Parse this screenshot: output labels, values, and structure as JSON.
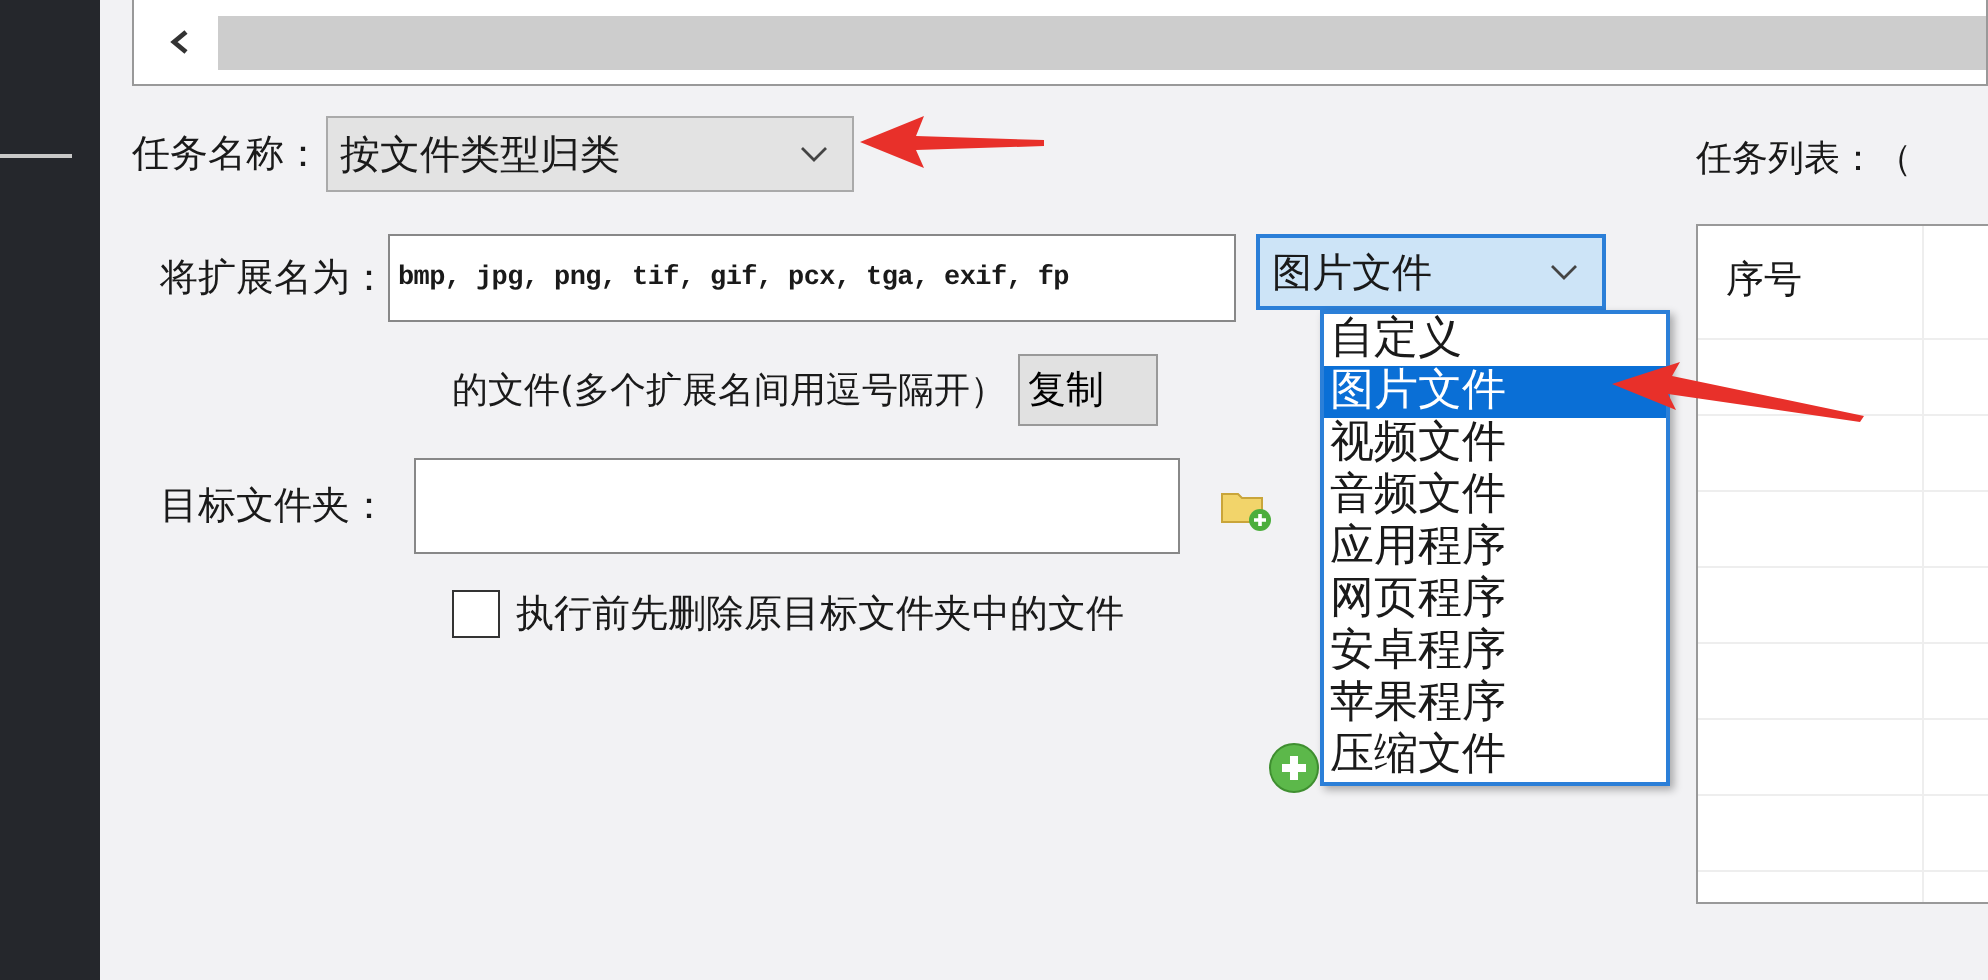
{
  "task_name": {
    "label": "任务名称：",
    "value": "按文件类型归类"
  },
  "extension": {
    "label": "将扩展名为：",
    "value": "bmp, jpg, png, tif, gif, pcx, tga, exif, fp",
    "category": "图片文件",
    "hint": "的文件(多个扩展名间用逗号隔开）",
    "copy_button": "复制"
  },
  "category_options": [
    {
      "label": "自定义",
      "selected": false
    },
    {
      "label": "图片文件",
      "selected": true
    },
    {
      "label": "视频文件",
      "selected": false
    },
    {
      "label": "音频文件",
      "selected": false
    },
    {
      "label": "应用程序",
      "selected": false
    },
    {
      "label": "网页程序",
      "selected": false
    },
    {
      "label": "安卓程序",
      "selected": false
    },
    {
      "label": "苹果程序",
      "selected": false
    },
    {
      "label": "压缩文件",
      "selected": false
    }
  ],
  "target_folder": {
    "label": "目标文件夹："
  },
  "delete_first": {
    "label": "执行前先删除原目标文件夹中的文件",
    "checked": false
  },
  "task_list": {
    "label": "任务列表：（",
    "columns": [
      "序号"
    ]
  }
}
